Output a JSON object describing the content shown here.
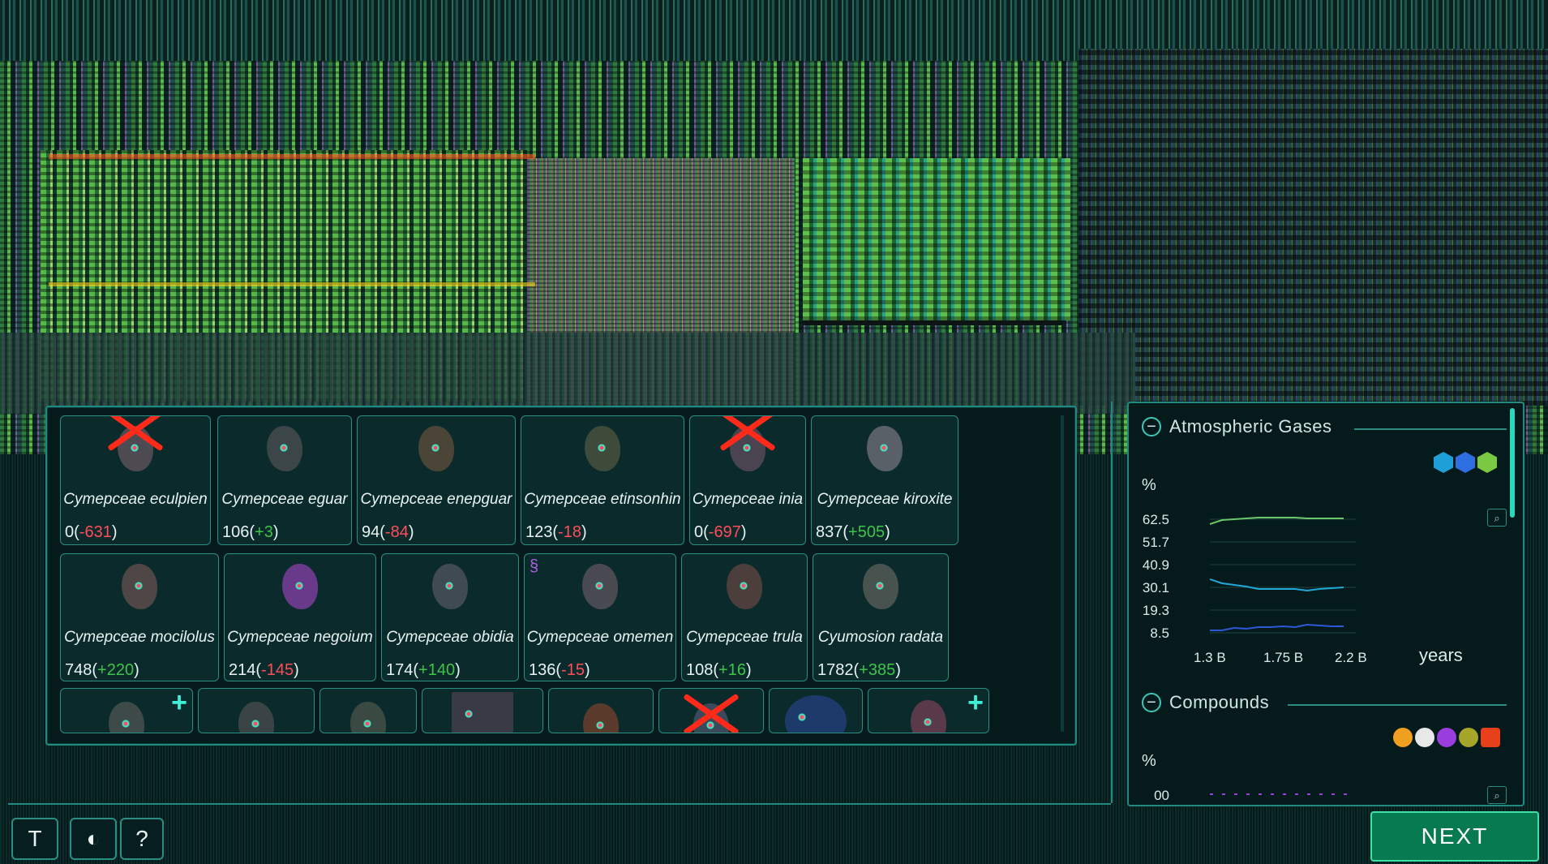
{
  "species": {
    "row1": [
      {
        "name": "Cymepceae eculpien",
        "count": "0",
        "delta": "-631",
        "extinct": true
      },
      {
        "name": "Cymepceae eguar",
        "count": "106",
        "delta": "+3",
        "extinct": false
      },
      {
        "name": "Cymepceae enepguar",
        "count": "94",
        "delta": "-84",
        "extinct": false
      },
      {
        "name": "Cymepceae etinsonhin",
        "count": "123",
        "delta": "-18",
        "extinct": false
      },
      {
        "name": "Cymepceae inia",
        "count": "0",
        "delta": "-697",
        "extinct": true
      },
      {
        "name": "Cymepceae kiroxite",
        "count": "837",
        "delta": "+505",
        "extinct": false
      }
    ],
    "row2": [
      {
        "name": "Cymepceae mocilolus",
        "count": "748",
        "delta": "+220"
      },
      {
        "name": "Cymepceae negoium",
        "count": "214",
        "delta": "-145"
      },
      {
        "name": "Cymepceae obidia",
        "count": "174",
        "delta": "+140"
      },
      {
        "name": "Cymepceae omemen",
        "count": "136",
        "delta": "-15"
      },
      {
        "name": "Cymepceae trula",
        "count": "108",
        "delta": "+16"
      },
      {
        "name": "Cyumosion radata",
        "count": "1782",
        "delta": "+385"
      }
    ]
  },
  "atmospheric": {
    "title": "Atmospheric Gases",
    "unit": "%",
    "yticks": [
      "62.5",
      "51.7",
      "40.9",
      "30.1",
      "19.3",
      "8.5"
    ],
    "xticks": [
      "1.3 B",
      "1.75 B",
      "2.2 B"
    ],
    "xunit": "years",
    "icons": [
      "oxygen-icon",
      "cloud-icon",
      "nitrogen-icon"
    ],
    "colors": {
      "oxygen": "#1f9fd8",
      "cloud": "#2f6ee0",
      "nitrogen": "#7ac943"
    }
  },
  "compounds": {
    "title": "Compounds",
    "unit": "%",
    "ytick_partial": "00",
    "icons": [
      "compound-orange-icon",
      "compound-white-icon",
      "compound-purple-icon",
      "compound-olive-icon",
      "compound-red-icon"
    ],
    "colors": [
      "#f0a020",
      "#e8e8e8",
      "#9a3ee0",
      "#a6a62a",
      "#e8401a"
    ]
  },
  "bottom": {
    "time_icon": "T",
    "globe_icon": "◐",
    "help_label": "?",
    "next_label": "NEXT"
  },
  "chart_data": {
    "type": "line",
    "title": "Atmospheric Gases",
    "xlabel": "years",
    "ylabel": "%",
    "x": [
      "1.3 B",
      "1.75 B",
      "2.2 B"
    ],
    "series": [
      {
        "values": [
          60,
          62,
          62
        ]
      },
      {
        "values": [
          35,
          30,
          32
        ]
      },
      {
        "values": [
          8,
          10,
          9
        ]
      }
    ],
    "ylim": [
      8.5,
      62.5
    ]
  }
}
